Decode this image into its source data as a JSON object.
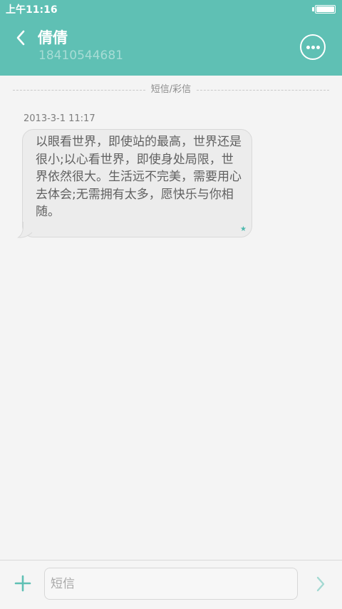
{
  "status_bar": {
    "time": "上午11:16",
    "battery_level": 1.0
  },
  "header": {
    "contact_name": "倩倩",
    "phone_number": "18410544681",
    "icons": {
      "back": "chevron-left-icon",
      "more": "more-horizontal-icon"
    }
  },
  "conversation": {
    "divider_label": "短信/彩信",
    "messages": [
      {
        "timestamp": "2013-3-1 11:17",
        "text": "以眼看世界，即使站的最高，世界还是很小;以心看世界，即使身处局限，世界依然很大。生活远不完美，需要用心去体会;无需拥有太多，愿快乐与你相随。",
        "status_icon": "star-icon"
      }
    ]
  },
  "composer": {
    "placeholder": "短信",
    "value": "",
    "icons": {
      "add": "plus-icon",
      "send": "chevron-right-icon"
    }
  },
  "colors": {
    "accent": "#5fc0b4",
    "background": "#f4f4f4",
    "bubble": "#ececec",
    "message_text": "#616161",
    "subtitle": "#a7dcd5",
    "star": "#4db8ad"
  }
}
